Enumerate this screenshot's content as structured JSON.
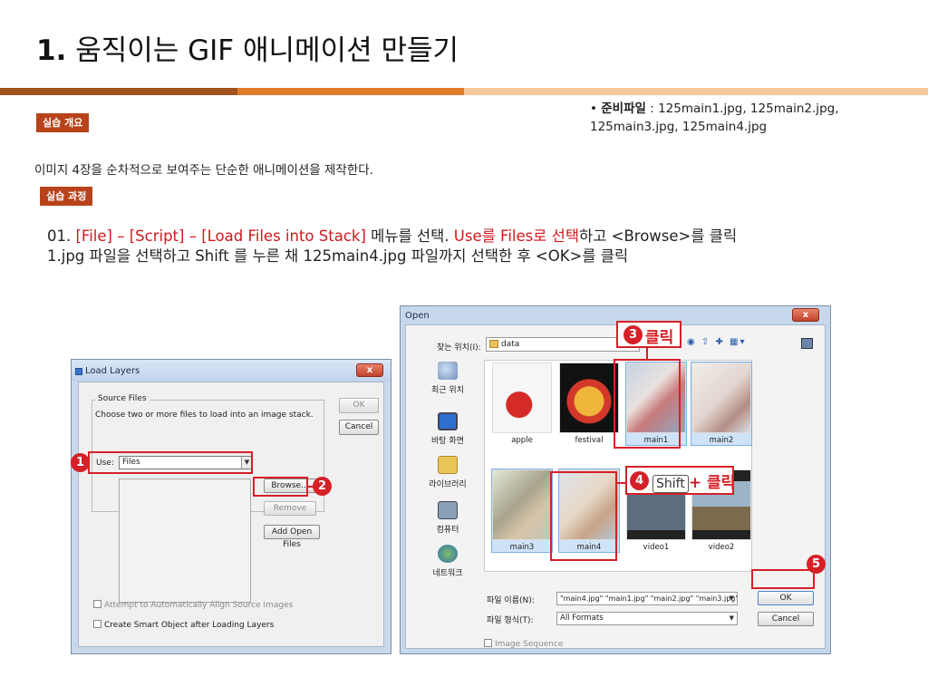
{
  "slide": {
    "title_num": "1.",
    "title_text": " 움직이는 GIF 애니메이션 만들기"
  },
  "prep_files": {
    "bullet": "• ",
    "label": "준비파일",
    "value": " : 125main1.jpg, 125main2.jpg, 125main3.jpg,  125main4.jpg"
  },
  "tags": {
    "overview": "실습 개요",
    "process": "실습 과정"
  },
  "overview_text": "이미지 4장을 순차적으로 보여주는 단순한 애니메이션을 제작한다.",
  "steps": {
    "prefix": "01. ",
    "menu_path": "[File] – [Script] – [Load Files into Stack]",
    "menu_suffix": " 메뉴를 선택. ",
    "use_files": "Use를 Files로 선택",
    "browse_text": "하고 <Browse>를 클릭",
    "line2": "1.jpg 파일을 선택하고 Shift 를 누른 채 125main4.jpg 파일까지 선택한 후 <OK>를 클릭"
  },
  "load_layers": {
    "title": "Load Layers",
    "close": "x",
    "group_label": "Source Files",
    "group_desc": "Choose two or more files to load into an image stack.",
    "use_label": "Use:",
    "use_value": "Files",
    "browse": "Browse...",
    "remove": "Remove",
    "add_open": "Add Open Files",
    "ok": "OK",
    "cancel": "Cancel",
    "align": "Attempt to Automatically Align Source Images",
    "smart": "Create Smart Object after Loading Layers"
  },
  "open_dialog": {
    "title": "Open",
    "close": "x",
    "look_in_label": "찾는 위치(I):",
    "look_in_value": "data",
    "places": [
      "최근 위치",
      "바탕 화면",
      "라이브러리",
      "컴퓨터",
      "네트워크"
    ],
    "thumbs": [
      "apple",
      "festival",
      "main1",
      "main2",
      "main3",
      "main4",
      "video1",
      "video2"
    ],
    "filename_label": "파일 이름(N):",
    "filename_value": "\"main4.jpg\" \"main1.jpg\" \"main2.jpg\" \"main3.jpg\"",
    "filetype_label": "파일 형식(T):",
    "filetype_value": "All Formats",
    "ok": "OK",
    "cancel": "Cancel",
    "image_sequence": "Image Sequence"
  },
  "annotations": {
    "badges": [
      "1",
      "2",
      "3",
      "4",
      "5"
    ],
    "click": "클릭",
    "shift": "Shift",
    "shift_click": "+ 클릭"
  },
  "colors": {
    "accent_red": "#d62028",
    "tag_bg": "#b8431b",
    "bar_brown": "#a0521c",
    "bar_orange": "#e07b28",
    "bar_peach": "#f6c89e"
  }
}
